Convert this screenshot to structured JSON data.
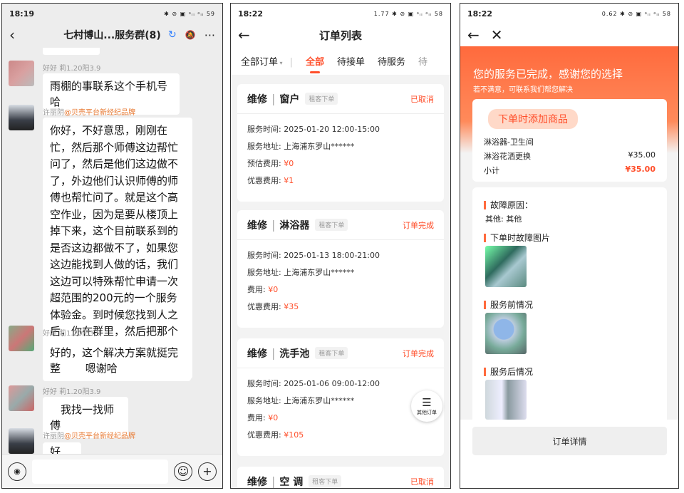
{
  "chat": {
    "time": "18:19",
    "status_right": "✱ ⊘ ▣ ᵃᵢᵢ ᵃᵢᵢ 59",
    "title": "七村博山...服务群(8)",
    "messages": [
      {
        "name": "好好 莉1.20阳3.9",
        "tag": "",
        "text": "雨棚的事联系这个手机号哈"
      },
      {
        "name": "许丽阴",
        "tag": "@贝壳平台新经纪品牌",
        "text": "你好，不好意思，刚刚在忙，然后那个师傅这边帮忙问了，然后是他们这边做不了，外边他们认识师傅的师傅也帮忙问了。就是这个高空作业，因为是要从楼顶上掉下来，这个目前联系到的是否这边都做不了，如果您这边能找到人做的话，我们这边可以特殊帮忙申请一次超范围的200元的一个服务体验金。到时候您找到人之后，你在群里，然后把那个银行卡号发群里，然后同事会给你出款。"
      },
      {
        "name": "好好 莉1.20阳3.9",
        "tag": "",
        "text": "好的，这个解决方案就挺完整 　　嗯谢哈"
      },
      {
        "name": "好好 莉1.20阳3.9",
        "tag": "",
        "text": "　我找一找师傅"
      },
      {
        "name": "许丽阴",
        "tag": "@贝壳平台新经纪品牌",
        "text": "好的。"
      }
    ]
  },
  "orders": {
    "time": "18:22",
    "status_right": "1.77 ✱ ⊘ ▣ ᵃᵢᵢ ᵃᵢᵢ 58",
    "title": "订单列表",
    "tabs": [
      "全部订单",
      "全部",
      "待接单",
      "待服务",
      "待"
    ],
    "cards": [
      {
        "type": "维修",
        "item": "窗户",
        "badge": "租客下单",
        "status": "已取消",
        "rows": [
          [
            "服务时间: ",
            "2025-01-20 12:00-15:00",
            false
          ],
          [
            "服务地址: ",
            "上海浦东罗山******",
            false
          ],
          [
            "预估费用: ",
            "¥0",
            true
          ],
          [
            "优惠费用: ",
            "¥1",
            true
          ]
        ]
      },
      {
        "type": "维修",
        "item": "淋浴器",
        "badge": "租客下单",
        "status": "订单完成",
        "rows": [
          [
            "服务时间: ",
            "2025-01-13 18:00-21:00",
            false
          ],
          [
            "服务地址: ",
            "上海浦东罗山******",
            false
          ],
          [
            "费用: ",
            "¥0",
            true
          ],
          [
            "优惠费用: ",
            "¥35",
            true
          ]
        ]
      },
      {
        "type": "维修",
        "item": "洗手池",
        "badge": "租客下单",
        "status": "订单完成",
        "rows": [
          [
            "服务时间: ",
            "2025-01-06 09:00-12:00",
            false
          ],
          [
            "服务地址: ",
            "上海浦东罗山******",
            false
          ],
          [
            "费用: ",
            "¥0",
            true
          ],
          [
            "优惠费用: ",
            "¥105",
            true
          ]
        ]
      },
      {
        "type": "维修",
        "item": "空 调",
        "badge": "租客下单",
        "status": "已取消",
        "rows": []
      }
    ],
    "fab_label": "其他订单"
  },
  "detail": {
    "time": "18:22",
    "status_right": "0.62 ✱ ⊘ ▣ ᵃᵢᵢ ᵃᵢᵢ 58",
    "headline": "您的服务已完成，感谢您的选择",
    "subline": "若不满意，可联系我们帮您解决",
    "section_added": "下单时添加商品",
    "category": "淋浴器-卫生间",
    "item_name": "淋浴花洒更换",
    "item_price": "¥35.00",
    "subtotal_label": "小计",
    "subtotal": "¥35.00",
    "fault_title": "故障原因：",
    "fault_text": "其他: 其他",
    "photo_sec1": "下单时故障图片",
    "photo_sec2": "服务前情况",
    "photo_sec3": "服务后情况",
    "details_button": "订单详情"
  }
}
